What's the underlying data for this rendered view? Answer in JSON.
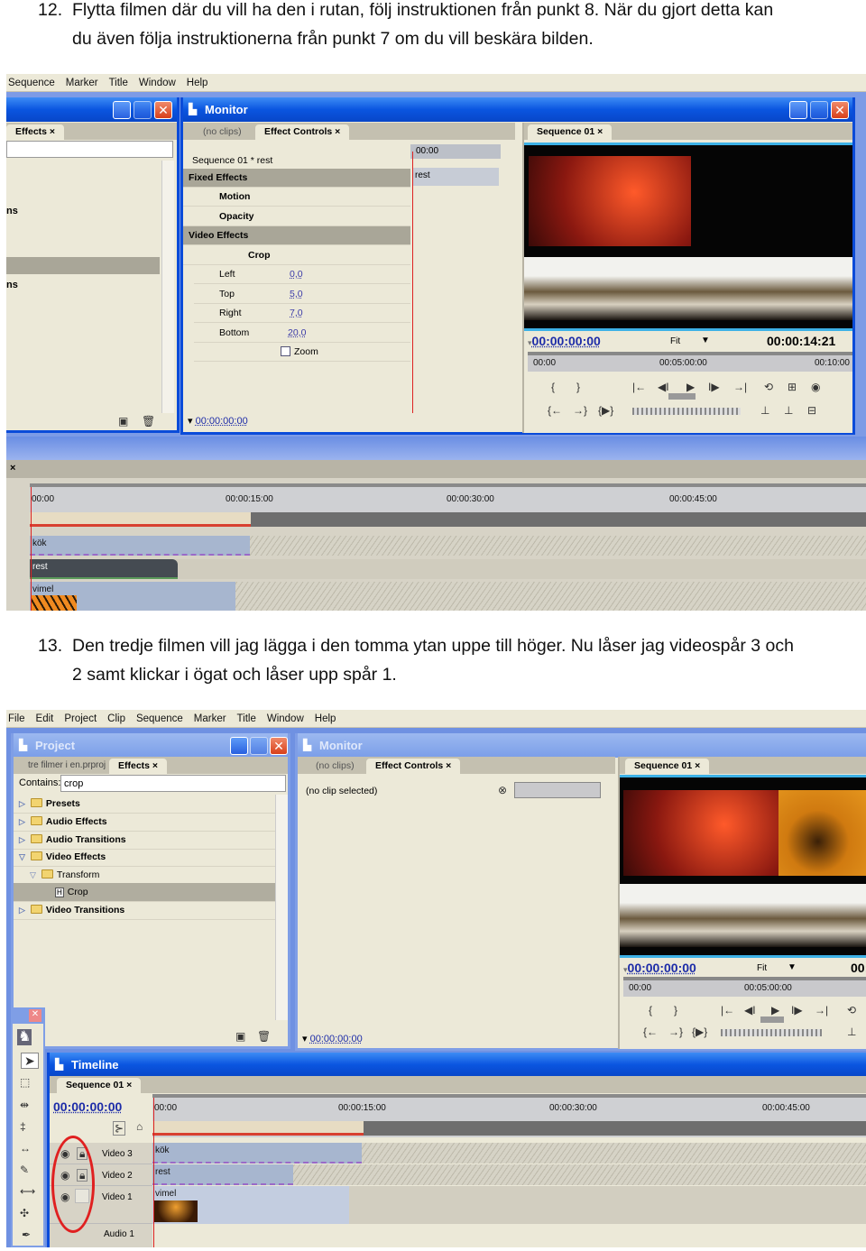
{
  "step12": {
    "number": "12.",
    "line1": "Flytta filmen där du vill ha den i rutan, följ instruktionen från punkt 8. När du gjort detta kan",
    "line2": "du även följa instruktionerna från punkt 7 om du vill beskära bilden."
  },
  "step13": {
    "number": "13.",
    "line1": "Den tredje filmen vill jag lägga i den tomma ytan uppe till höger. Nu låser jag videospår 3 och",
    "line2": "2 samt klickar i ögat och låser upp spår 1."
  },
  "shot1": {
    "menu": [
      "Sequence",
      "Marker",
      "Title",
      "Window",
      "Help"
    ],
    "left_tab": "Effects",
    "left_cut1": "ns",
    "left_cut2": "ns",
    "monitor_title": "Monitor",
    "tab_noclips": "(no clips)",
    "tab_effect_controls": "Effect Controls",
    "seq_label": "Sequence 01 * rest",
    "fixed_effects": "Fixed Effects",
    "motion": "Motion",
    "opacity": "Opacity",
    "video_effects": "Video Effects",
    "crop": "Crop",
    "params": [
      {
        "name": "Left",
        "value": "0,0"
      },
      {
        "name": "Top",
        "value": "5,0"
      },
      {
        "name": "Right",
        "value": "7,0"
      },
      {
        "name": "Bottom",
        "value": "20,0"
      }
    ],
    "zoom": "Zoom",
    "ec_time": "00:00",
    "ec_clip": "rest",
    "ec_footer_tc": "00:00:00:00",
    "seq_tab": "Sequence 01",
    "tc_current": "00:00:00:00",
    "fit": "Fit",
    "tc_duration": "00:00:14:21",
    "mon_ruler": [
      "00:00",
      "00:05:00:00",
      "00:10:00"
    ],
    "tl_ruler": [
      "00:00",
      "00:00:15:00",
      "00:00:30:00",
      "00:00:45:00"
    ],
    "clips": [
      "kök",
      "rest",
      "vimel"
    ]
  },
  "shot2": {
    "menu": [
      "File",
      "Edit",
      "Project",
      "Clip",
      "Sequence",
      "Marker",
      "Title",
      "Window",
      "Help"
    ],
    "project_title": "Project",
    "tab_project": "tre filmer i en.prproj",
    "tab_effects": "Effects",
    "contains_label": "Contains:",
    "search_value": "crop",
    "tree": [
      {
        "label": "Presets",
        "expanded": false
      },
      {
        "label": "Audio Effects",
        "expanded": false
      },
      {
        "label": "Audio Transitions",
        "expanded": false
      },
      {
        "label": "Video Effects",
        "expanded": true
      },
      {
        "label": "Transform",
        "expanded": true
      },
      {
        "label": "Crop",
        "selected": true
      },
      {
        "label": "Video Transitions",
        "expanded": false
      }
    ],
    "monitor_title": "Monitor",
    "tab_noclips": "(no clips)",
    "tab_effect_controls": "Effect Controls",
    "no_clip": "(no clip selected)",
    "ec_footer_tc": "00:00:00:00",
    "seq_tab": "Sequence 01",
    "tc_current": "00:00:00:00",
    "fit": "Fit",
    "tc_duration": "00:",
    "mon_ruler": [
      "00:00",
      "00:05:00:00"
    ],
    "timeline_title": "Timeline",
    "tl_tab": "Sequence 01",
    "tl_tc": "00:00:00:00",
    "tl_ruler": [
      "00:00",
      "00:00:15:00",
      "00:00:30:00",
      "00:00:45:00"
    ],
    "tracks": [
      "Video 3",
      "Video 2",
      "Video 1",
      "Audio 1"
    ],
    "clips": [
      "kök",
      "rest",
      "vimel"
    ],
    "annotation_color": "#e02020"
  }
}
